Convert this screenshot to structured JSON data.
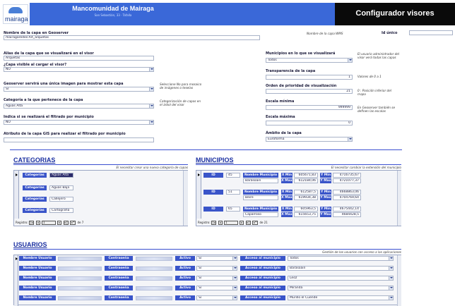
{
  "header": {
    "logo_text": "mairaga",
    "app_title": "Mancomunidad de Mairaga",
    "app_subtitle": "San Sebastián, 33 · Tafalla",
    "config_title": "Configurador visores"
  },
  "form": {
    "layer_name_label": "Nombre de la capa en Geoserver",
    "layer_name_value": "mairagaredes:AA_arquetas",
    "layer_name_hint": "Nombre de la capa WMS",
    "id_label": "Id único",
    "id_value": "",
    "alias_label": "Alias de la capa que se visualizará en el visor",
    "alias_value": "Arquetas",
    "visible_label": "¿Capa visible al cargar el visor?",
    "visible_value": "NO",
    "single_image_label": "Geoserver servirá una única imagen para mostrar esta capa",
    "single_image_value": "SI",
    "single_image_hint": "Seleccione No para mosaico de imágenes o teselas",
    "category_label": "Categoría a la que pertenece de la capa",
    "category_value": "Aguas Alta",
    "category_hint": "Categorización de capas en el árbol del visor",
    "filter_label": "Indica si se realizará el filtrado por municipio",
    "filter_value": "NO",
    "attribute_label": "Atributo de la capa GIS para realizar el filtrado por municipio",
    "attribute_value": "",
    "municipios_label": "Municipios en lo que se visualizará",
    "municipios_value": "Todos",
    "municipios_hint": "El usuario administrador del visor verá todas las capas",
    "transparency_label": "Transparencia de la capa",
    "transparency_value": "1",
    "transparency_hint": "Valores de 0 a 1",
    "order_label": "Orden de prioridad de visualización",
    "order_value": "21",
    "order_hint": "0 : Posición inferior del mapa",
    "scale_min_label": "Escala mínima",
    "scale_min_value": "999999",
    "scale_max_label": "Escala máxima",
    "scale_max_value": "0",
    "scale_hint": "En Geoserver también se definen las escalas",
    "ambito_label": "Ámbito de la capa",
    "ambito_value": "Euroforma"
  },
  "categorias": {
    "title": "CATEGORIAS",
    "hint": "El necesitar crear una nueva categoría de capas",
    "col_label": "Categorías",
    "rows": [
      "Aguas Alta",
      "Aguas Baja",
      "Callejero",
      "Cartografía"
    ],
    "nav_label": "Registro:",
    "nav_current": "1",
    "nav_total": "de 7"
  },
  "municipios": {
    "title": "MUNICIPIOS",
    "hint": "El necesitar cambiar la extensión del municipio",
    "id_label": "ID",
    "name_label": "Nombre Municipio",
    "xmin_label": "X Min",
    "xmax_label": "X Max",
    "ymin_label": "Y Min",
    "ymax_label": "Y Max",
    "rows": [
      {
        "id": "45",
        "name": "Barásoain",
        "xmin": "605671,83",
        "xmax": "612184,06",
        "ymin": "4716735,67",
        "ymax": "4721077,37"
      },
      {
        "id": "51",
        "name": "Beire",
        "xmin": "612587,5",
        "xmax": "619934,38",
        "ymin": "4668863,06",
        "ymax": "4704769,64"
      },
      {
        "id": "65",
        "name": "Caparroso",
        "xmin": "605963,5",
        "xmax": "615653,75",
        "ymin": "4675442,14",
        "ymax": "4684428,5"
      }
    ],
    "nav_label": "Registro:",
    "nav_current": "1",
    "nav_total": "de 21"
  },
  "usuarios": {
    "title": "USUARIOS",
    "hint": "Gestión de los usuarios con acceso a las aplicaciones",
    "user_label": "Nombre Usuario",
    "pass_label": "Contraseña",
    "active_label": "Activo",
    "access_label": "Acceso al municipio",
    "rows": [
      {
        "active": "Sí",
        "access": "Todos"
      },
      {
        "active": "Sí",
        "access": "Barásoain"
      },
      {
        "active": "Sí",
        "access": "Leoz"
      },
      {
        "active": "Sí",
        "access": "Miranda"
      },
      {
        "active": "Sí",
        "access": "Murillo el Cuende"
      }
    ]
  },
  "colors": {
    "header_blue": "#3a68d8",
    "header_black": "#0a0a0a",
    "grid_header_blue": "#3a55c9",
    "section_title": "#1a2fa0"
  }
}
